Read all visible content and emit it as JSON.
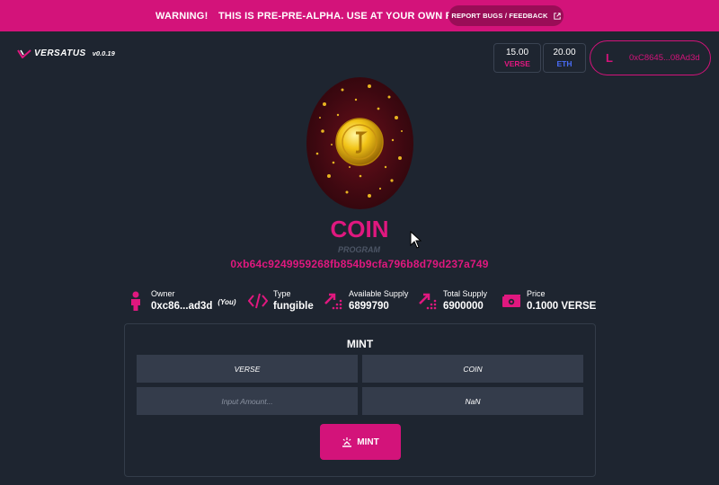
{
  "banner": {
    "warning": "WARNING!",
    "message": "THIS IS PRE-PRE-ALPHA. USE AT YOUR OWN RISK.",
    "report_label": "REPORT BUGS / FEEDBACK"
  },
  "header": {
    "logo_text": "VERSATUS",
    "version": "v0.0.19",
    "balances": [
      {
        "amount": "15.00",
        "token": "VERSE"
      },
      {
        "amount": "20.00",
        "token": "ETH"
      }
    ],
    "wallet": {
      "initial": "L",
      "address": "0xC8645...08Ad3d"
    }
  },
  "program": {
    "name": "COIN",
    "type_label": "PROGRAM",
    "address": "0xb64c9249959268fb854b9cfa796b8d79d237a749"
  },
  "info": {
    "owner": {
      "label": "Owner",
      "value": "0xc86...ad3d",
      "you": "(You)"
    },
    "type": {
      "label": "Type",
      "value": "fungible"
    },
    "available_supply": {
      "label": "Available Supply",
      "value": "6899790"
    },
    "total_supply": {
      "label": "Total Supply",
      "value": "6900000"
    },
    "price": {
      "label": "Price",
      "value": "0.1000 VERSE"
    }
  },
  "mint": {
    "title": "MINT",
    "from_token": "VERSE",
    "to_token": "COIN",
    "amount_placeholder": "Input Amount...",
    "output_value": "NaN",
    "button_label": "MINT"
  },
  "colors": {
    "accent": "#d3137a",
    "background": "#1e2530",
    "eth": "#4a6cf7"
  }
}
